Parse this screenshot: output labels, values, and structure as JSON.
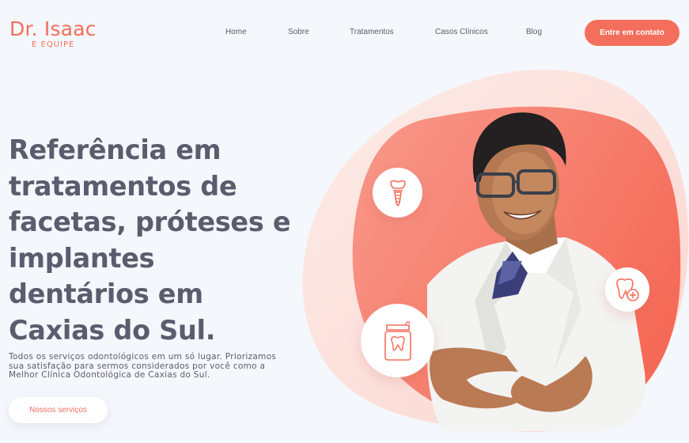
{
  "brand": {
    "name": "Dr. Isaac",
    "subtitle": "E EQUIPE"
  },
  "nav": {
    "items": [
      {
        "label": "Home"
      },
      {
        "label": "Sobre"
      },
      {
        "label": "Tratamentos"
      },
      {
        "label": "Casos Clínicos"
      },
      {
        "label": "Blog"
      }
    ],
    "cta_label": "Entre em contato"
  },
  "hero": {
    "headline_lines": [
      "Referência em",
      "tratamentos de",
      "facetas, próteses e",
      "implantes",
      "dentários em",
      "Caxias do Sul."
    ],
    "description_lines": [
      "Todos os serviços odontológicos em um só lugar. Priorizamos",
      "sua satisfação para sermos considerados por você como a",
      "Melhor Clínica Odontológica de Caxias do Sul."
    ],
    "button_label": "Nossos serviços",
    "image": {
      "icons": [
        "dental-implant-icon",
        "tooth-plus-icon",
        "dental-floss-icon"
      ]
    }
  },
  "colors": {
    "accent": "#f46e5c",
    "text": "#5b5c6e",
    "background": "#f4f7fb"
  }
}
